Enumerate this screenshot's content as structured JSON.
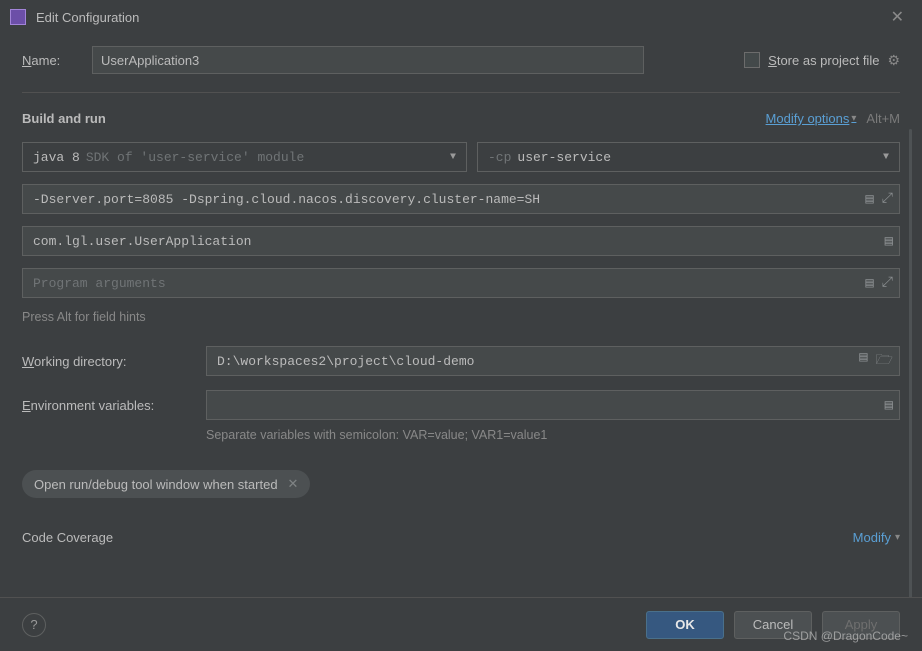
{
  "titlebar": {
    "title": "Edit Configuration"
  },
  "name": {
    "label": "Name:",
    "value": "UserApplication3",
    "store_label": "Store as project file"
  },
  "build_run": {
    "title": "Build and run",
    "modify_label": "Modify options",
    "shortcut": "Alt+M",
    "sdk": {
      "prefix": "java 8",
      "suffix": "SDK of 'user-service' module"
    },
    "classpath": {
      "prefix": "-cp",
      "value": "user-service"
    },
    "vm_options": "-Dserver.port=8085 -Dspring.cloud.nacos.discovery.cluster-name=SH",
    "main_class": "com.lgl.user.UserApplication",
    "program_args_placeholder": "Program arguments",
    "hint": "Press Alt for field hints",
    "working_dir_label": "Working directory:",
    "working_dir_value": "D:\\workspaces2\\project\\cloud-demo",
    "env_label": "Environment variables:",
    "env_value": "",
    "env_help": "Separate variables with semicolon: VAR=value; VAR1=value1",
    "chip": "Open run/debug tool window when started"
  },
  "coverage": {
    "title": "Code Coverage",
    "modify_label": "Modify"
  },
  "footer": {
    "ok": "OK",
    "cancel": "Cancel",
    "apply": "Apply"
  },
  "watermark": "CSDN @DragonCode~"
}
